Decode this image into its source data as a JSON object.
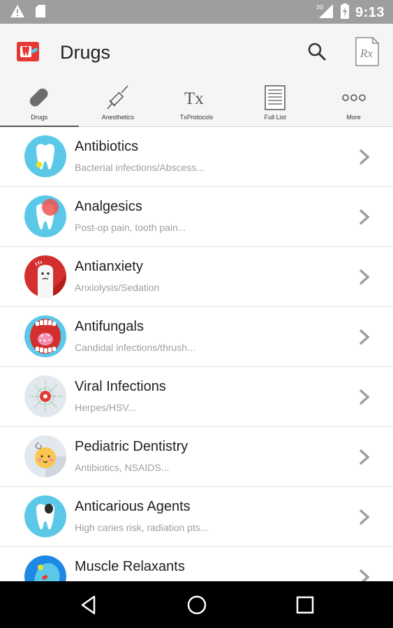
{
  "status_bar": {
    "time": "9:13",
    "network": "3G",
    "icons": [
      "warning-icon",
      "sd-card-icon",
      "signal-icon",
      "battery-icon"
    ]
  },
  "app_bar": {
    "title": "Drugs",
    "logo_icon": "app-logo-icon",
    "search_icon": "search-icon",
    "rx_icon": "rx-prescription-icon",
    "rx_text": "Rx"
  },
  "tabs": [
    {
      "label": "Drugs",
      "icon": "capsule-icon",
      "active": true
    },
    {
      "label": "Anesthetics",
      "icon": "syringe-icon",
      "active": false
    },
    {
      "label": "TxProtocols",
      "icon": "tx-icon",
      "active": false
    },
    {
      "label": "Full List",
      "icon": "list-icon",
      "active": false
    },
    {
      "label": "More",
      "icon": "more-dots-icon",
      "active": false
    }
  ],
  "tx_glyph": "Tx",
  "categories": [
    {
      "title": "Antibiotics",
      "subtitle": "Bacterial infections/Abscess...",
      "icon": "tooth-bacteria-icon"
    },
    {
      "title": "Analgesics",
      "subtitle": "Post-op pain, tooth pain...",
      "icon": "tooth-pain-icon"
    },
    {
      "title": "Antianxiety",
      "subtitle": "Anxiolysis/Sedation",
      "icon": "anxious-tooth-icon"
    },
    {
      "title": "Antifungals",
      "subtitle": "Candidal infections/thrush...",
      "icon": "open-mouth-icon"
    },
    {
      "title": "Viral Infections",
      "subtitle": "Herpes/HSV...",
      "icon": "virus-icon"
    },
    {
      "title": "Pediatric Dentistry",
      "subtitle": "Antibiotics, NSAIDS...",
      "icon": "baby-face-icon"
    },
    {
      "title": "Anticarious Agents",
      "subtitle": "High caries risk, radiation pts...",
      "icon": "cavity-tooth-icon"
    },
    {
      "title": "Muscle Relaxants",
      "subtitle": "",
      "icon": "head-muscle-icon"
    }
  ],
  "colors": {
    "status_bar": "#9e9e9e",
    "app_bar": "#f5f5f5",
    "logo_red": "#e53935",
    "icon_blue": "#5bc8e8",
    "icon_red": "#d32f2f",
    "chevron": "#9e9e9e"
  },
  "nav": {
    "back_icon": "back-triangle-icon",
    "home_icon": "home-circle-icon",
    "recents_icon": "recents-square-icon"
  }
}
